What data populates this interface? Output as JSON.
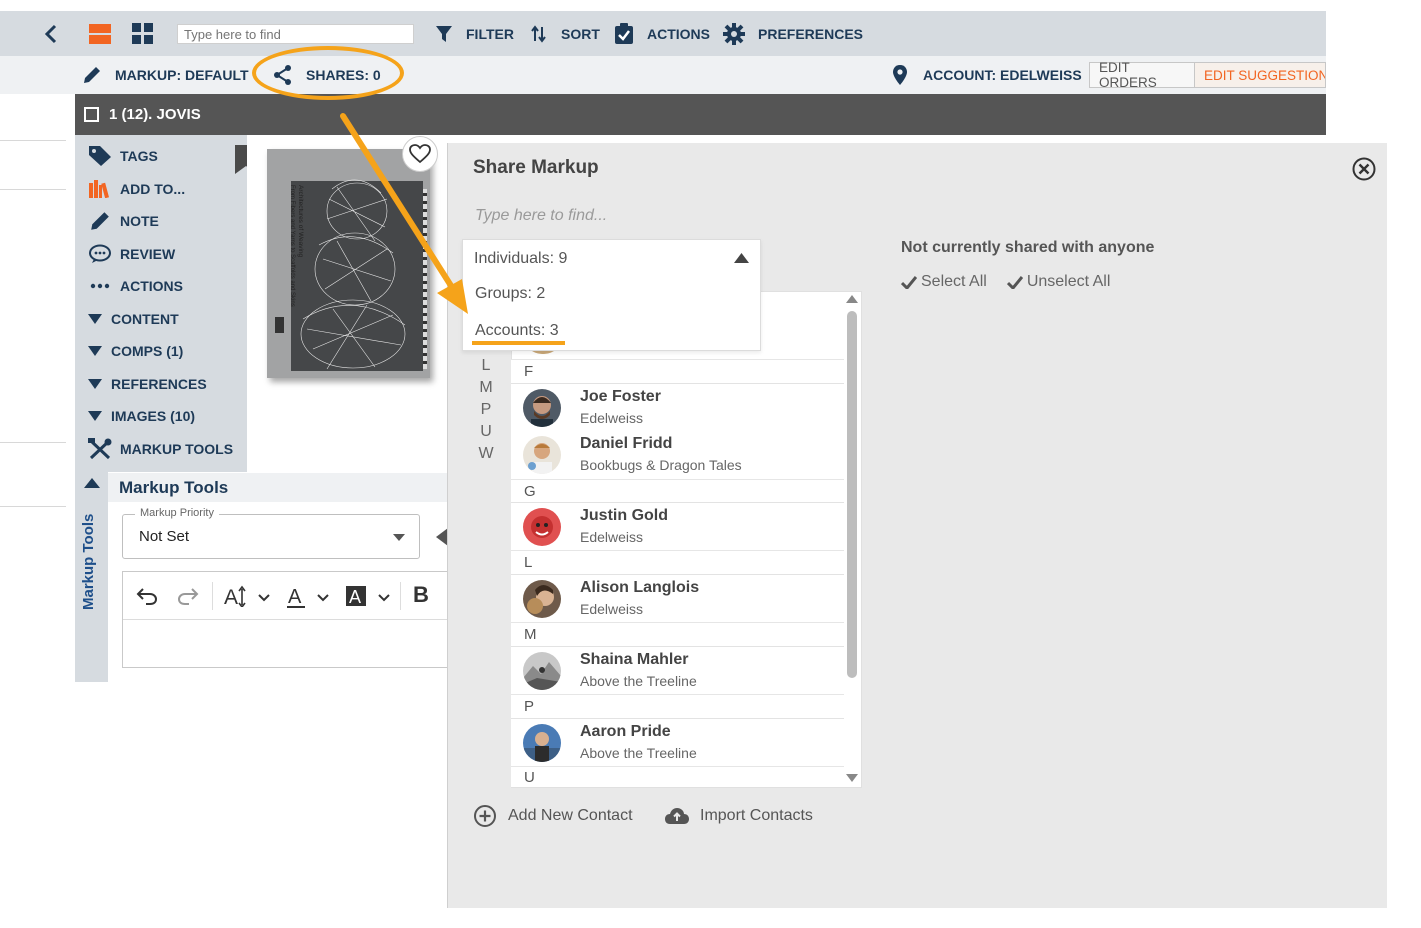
{
  "toolbar": {
    "search_placeholder": "Type here to find",
    "filter": "FILTER",
    "sort": "SORT",
    "actions": "ACTIONS",
    "preferences": "PREFERENCES"
  },
  "bar2": {
    "markup": "MARKUP: DEFAULT",
    "shares": "SHARES: 0",
    "account": "ACCOUNT: EDELWEISS",
    "edit_orders": "EDIT ORDERS",
    "edit_suggestions": "EDIT SUGGESTIONS"
  },
  "title": "1 (12). JOVIS",
  "sidebar": {
    "items": [
      "TAGS",
      "ADD TO...",
      "NOTE",
      "REVIEW",
      "ACTIONS",
      "CONTENT",
      "COMPS (1)",
      "REFERENCES",
      "IMAGES (10)",
      "MARKUP TOOLS"
    ]
  },
  "cover": {
    "line1": "Architectures of Weaving",
    "line2": "From Fibers and Yarns to Scaffolds and Skins"
  },
  "markup_tools": {
    "vertical_label": "Markup Tools",
    "heading": "Markup Tools",
    "priority_label": "Markup Priority",
    "priority_value": "Not Set",
    "bold": "B"
  },
  "share": {
    "title": "Share Markup",
    "find_placeholder": "Type here to find...",
    "status": "Not currently shared with anyone",
    "select_all": "Select All",
    "unselect_all": "Unselect All",
    "dropdown": {
      "individuals": "Individuals: 9",
      "groups": "Groups: 2",
      "accounts": "Accounts: 3"
    },
    "alpha_index": [
      "L",
      "M",
      "P",
      "U",
      "W"
    ],
    "letters": [
      "F",
      "G",
      "L",
      "M",
      "P",
      "U"
    ],
    "contacts": [
      {
        "name": "Joe Foster",
        "org": "Edelweiss"
      },
      {
        "name": "Daniel Fridd",
        "org": "Bookbugs & Dragon Tales"
      },
      {
        "name": "Justin Gold",
        "org": "Edelweiss"
      },
      {
        "name": "Alison Langlois",
        "org": "Edelweiss"
      },
      {
        "name": "Shaina Mahler",
        "org": "Above the Treeline"
      },
      {
        "name": "Aaron Pride",
        "org": "Above the Treeline"
      }
    ],
    "add_contact": "Add New Contact",
    "import_contacts": "Import Contacts"
  },
  "colors": {
    "navy": "#1e3a57",
    "accent_orange": "#f5a31a",
    "brand_orange": "#f26522",
    "dark_bar": "#555555"
  }
}
